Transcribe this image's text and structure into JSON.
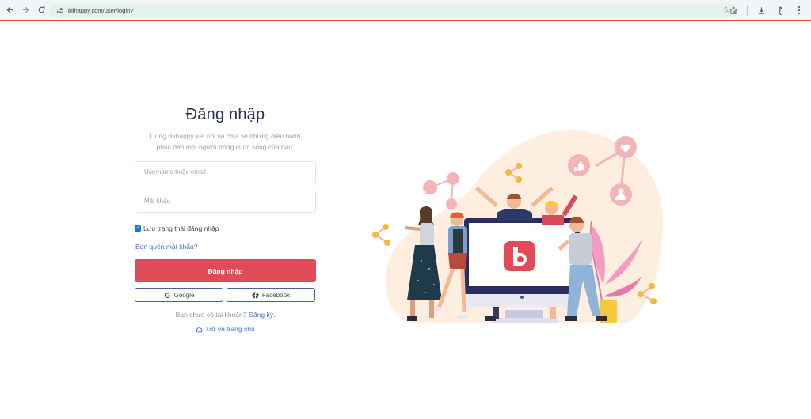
{
  "browser": {
    "url": "biihappy.com/user/login?",
    "icons": [
      "back-icon",
      "forward-icon",
      "reload-icon",
      "site-settings-icon",
      "bookmark-star-icon",
      "extensions-icon",
      "download-icon",
      "profile-icon",
      "menu-icon"
    ]
  },
  "login": {
    "title": "Đăng nhập",
    "subtitle_line1": "Cùng Biihappy kết nối và chia sẻ những điều hạnh",
    "subtitle_line2": "phúc đến mọi người trong cuộc sống của bạn.",
    "username_placeholder": "Username hoặc email",
    "password_placeholder": "Mật khẩu",
    "remember_label": "Lưu trạng thái đăng nhập",
    "remember_checked": true,
    "forgot_label": "Bạn quên mật khẩu?",
    "submit_label": "Đăng nhập",
    "google_label": "Google",
    "facebook_label": "Facebook",
    "signup_prompt": "Bạn chưa có tài khoản?",
    "signup_link": "Đăng ký.",
    "home_link": "Trở về trang chủ"
  },
  "colors": {
    "primary": "#e04b59",
    "link": "#4a6ed6",
    "title": "#25324a",
    "illustration_bg": "#fdeee0"
  }
}
